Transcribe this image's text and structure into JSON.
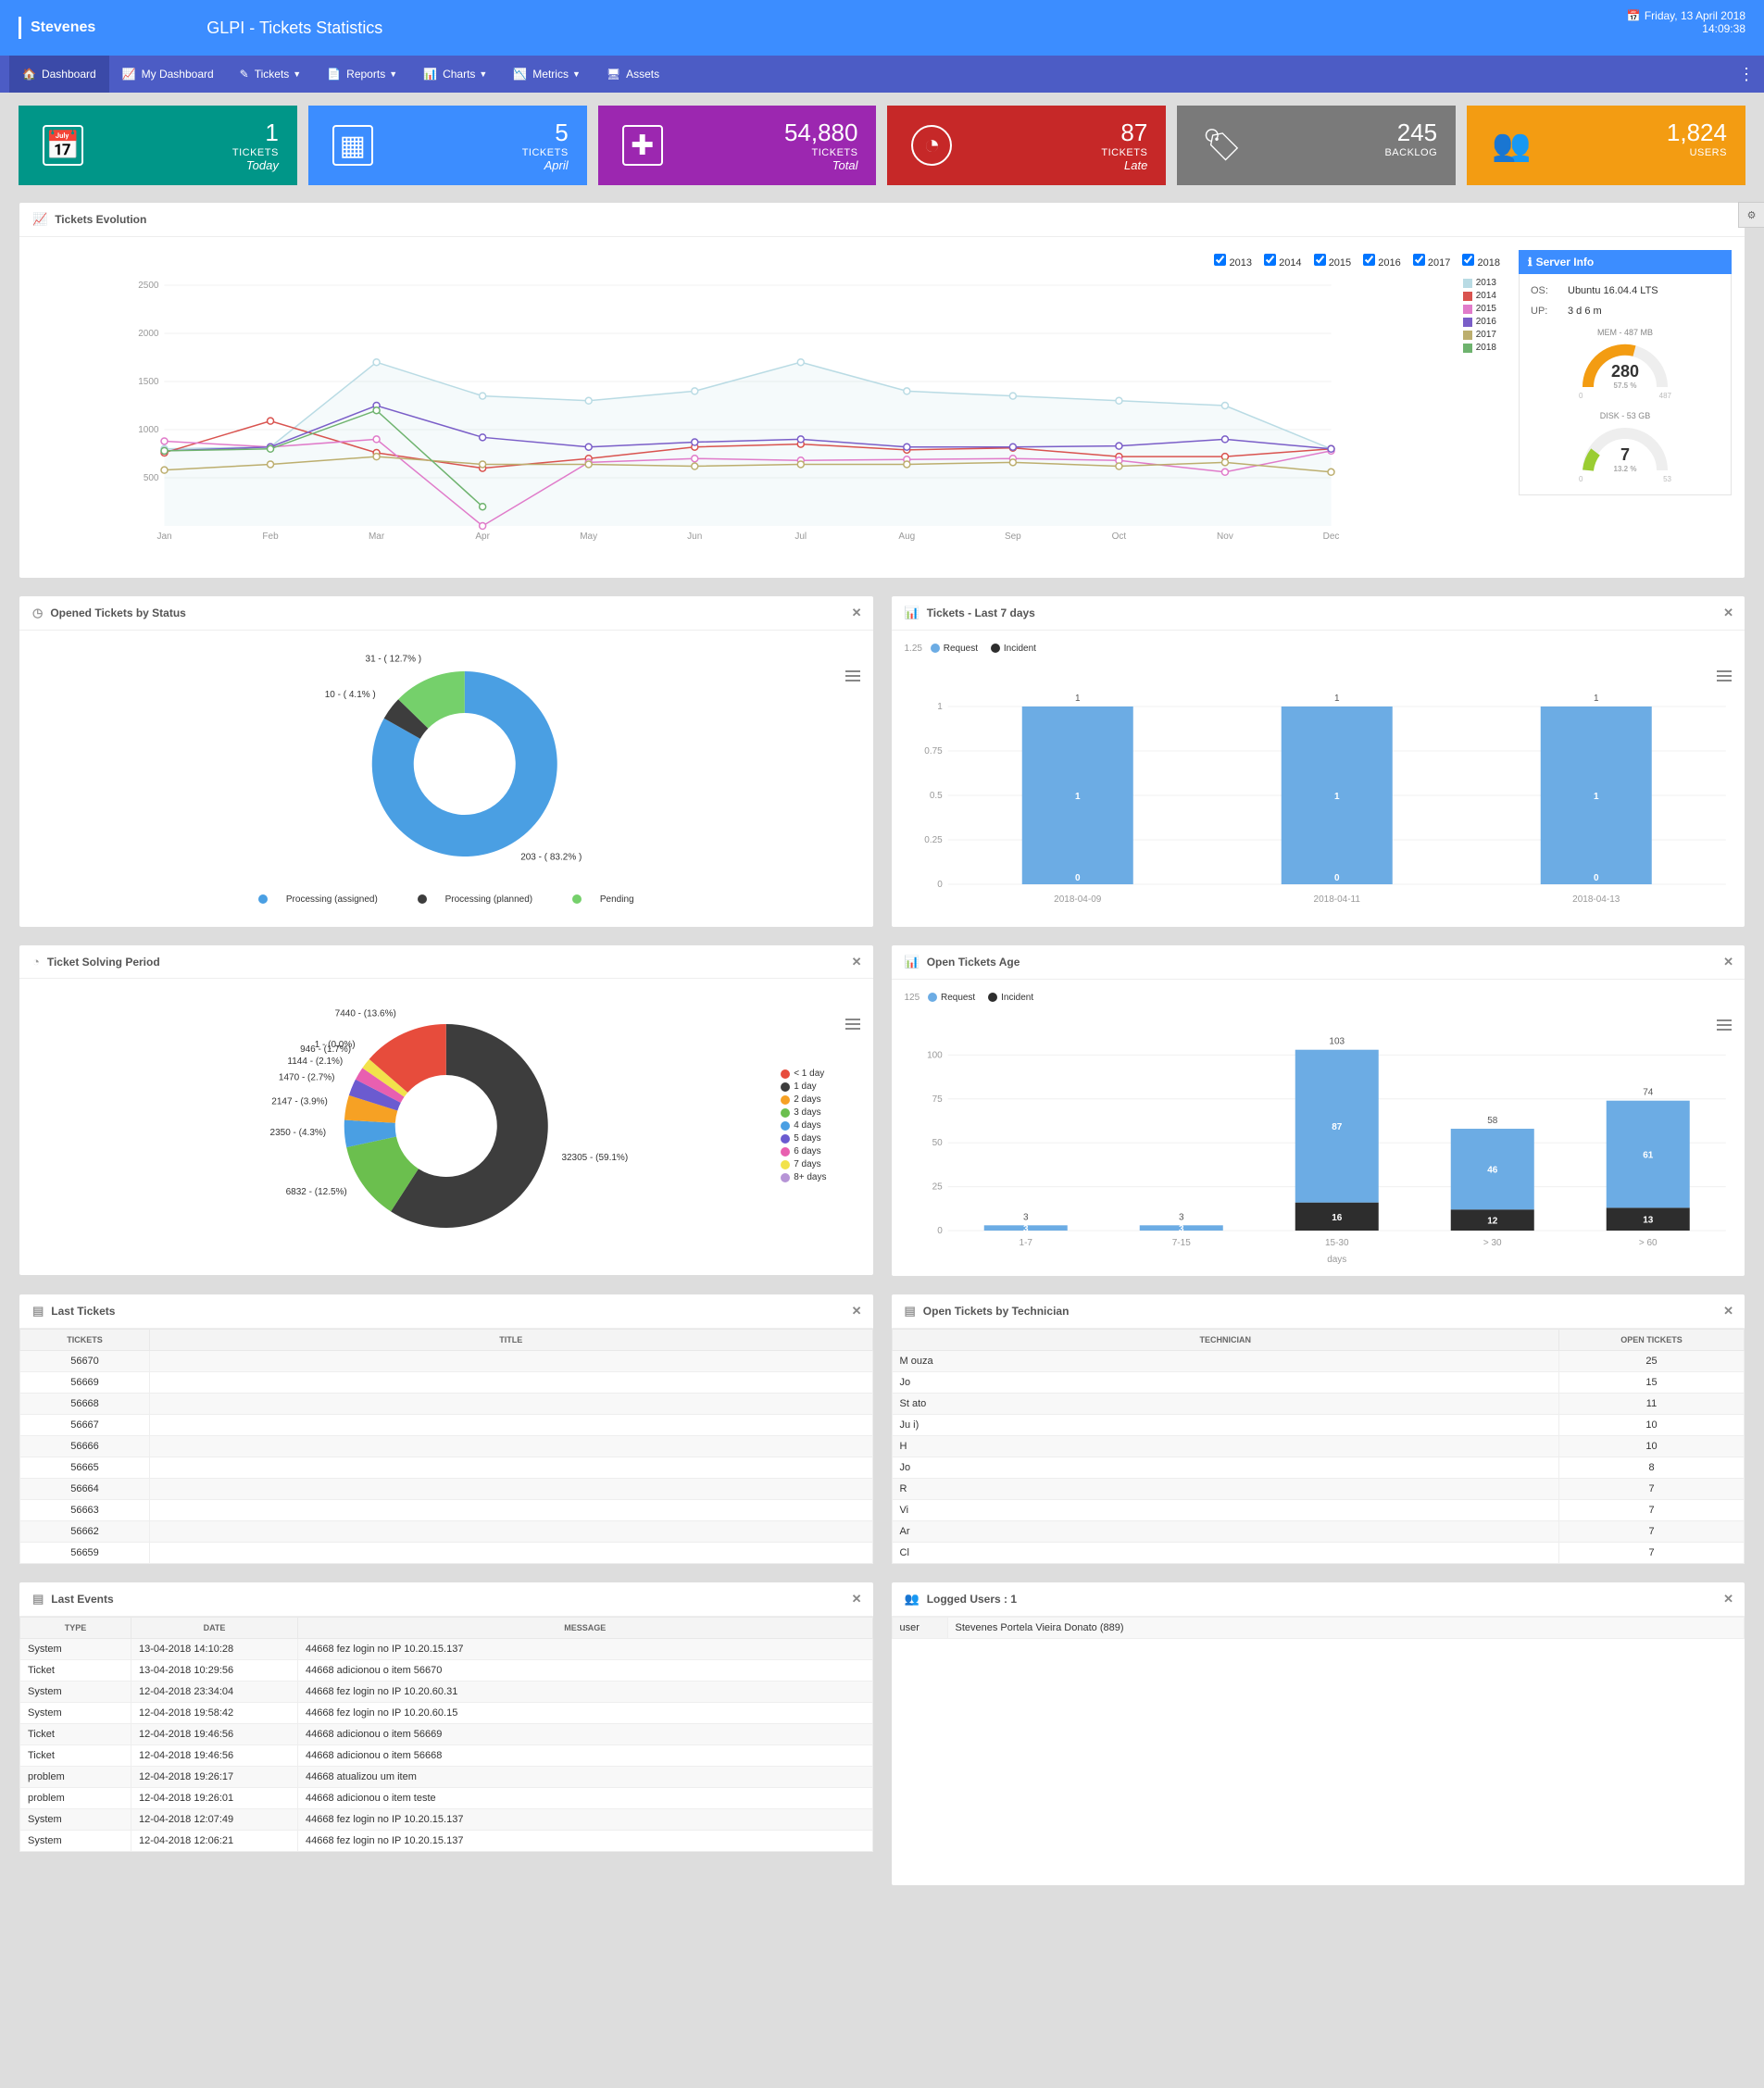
{
  "topbar": {
    "brand": "Stevenes",
    "title": "GLPI - Tickets Statistics",
    "date": "Friday, 13 April 2018",
    "time": "14:09:38"
  },
  "nav": {
    "dashboard": "Dashboard",
    "my_dashboard": "My Dashboard",
    "tickets": "Tickets",
    "reports": "Reports",
    "charts": "Charts",
    "metrics": "Metrics",
    "assets": "Assets"
  },
  "stats": {
    "today": {
      "number": "1",
      "label1": "TICKETS",
      "label2": "Today"
    },
    "april": {
      "number": "5",
      "label1": "TICKETS",
      "label2": "April"
    },
    "total": {
      "number": "54,880",
      "label1": "TICKETS",
      "label2": "Total"
    },
    "late": {
      "number": "87",
      "label1": "TICKETS",
      "label2": "Late"
    },
    "backlog": {
      "number": "245",
      "label1": "BACKLOG",
      "label2": ""
    },
    "users": {
      "number": "1,824",
      "label1": "USERS",
      "label2": ""
    }
  },
  "evolution": {
    "title": "Tickets Evolution",
    "years": [
      "2013",
      "2014",
      "2015",
      "2016",
      "2017",
      "2018"
    ],
    "server_info": {
      "title": "Server Info",
      "os_k": "OS:",
      "os_v": "Ubuntu 16.04.4 LTS",
      "up_k": "UP:",
      "up_v": "3 d 6 m",
      "mem_label": "MEM - 487 MB",
      "mem_val": "280",
      "mem_pct": "57.5 %",
      "mem_min": "0",
      "mem_max": "487",
      "disk_label": "DISK - 53 GB",
      "disk_val": "7",
      "disk_pct": "13.2 %",
      "disk_min": "0",
      "disk_max": "53"
    }
  },
  "status_pie": {
    "title": "Opened Tickets by Status",
    "l_proc_assigned": "Processing (assigned)",
    "l_proc_planned": "Processing (planned)",
    "l_pending": "Pending",
    "label_203": "203 - ( 83.2% )",
    "label_10": "10 - ( 4.1% )",
    "label_31": "31 - ( 12.7% )"
  },
  "last7": {
    "title": "Tickets - Last 7 days",
    "l_req": "Request",
    "l_inc": "Incident",
    "ytick_125": "1.25",
    "ytick_1": "1",
    "ytick_075": "0.75",
    "ytick_05": "0.5",
    "ytick_025": "0.25",
    "ytick_0": "0",
    "d1": "2018-04-09",
    "d2": "2018-04-11",
    "d3": "2018-04-13",
    "top1": "1",
    "top2": "1",
    "top3": "1",
    "mid1": "1",
    "mid2": "1",
    "mid3": "1",
    "bot1": "0",
    "bot2": "0",
    "bot3": "0"
  },
  "solving": {
    "title": "Ticket Solving Period",
    "leg": [
      "< 1 day",
      "1 day",
      "2 days",
      "3 days",
      "4 days",
      "5 days",
      "6 days",
      "7 days",
      "8+ days"
    ],
    "lbl_1": "1 - (0.0%)",
    "lbl_7440": "7440 - (13.6%)",
    "lbl_946": "946 - (1.7%)",
    "lbl_1144": "1144 - (2.1%)",
    "lbl_1470": "1470 - (2.7%)",
    "lbl_2147": "2147 - (3.9%)",
    "lbl_2350": "2350 - (4.3%)",
    "lbl_6832": "6832 - (12.5%)",
    "lbl_32305": "32305 - (59.1%)"
  },
  "age": {
    "title": "Open Tickets Age",
    "l_req": "Request",
    "l_inc": "Incident",
    "ymax": "125",
    "y100": "100",
    "y75": "75",
    "y50": "50",
    "y25": "25",
    "y0": "0",
    "xl": "days",
    "x1": "1-7",
    "x2": "7-15",
    "x3": "15-30",
    "x4": "> 30",
    "x5": "> 60",
    "top1": "3",
    "top2": "3",
    "top3": "103",
    "top4": "58",
    "top5": "74",
    "req1": "3",
    "req2": "3",
    "req3": "87",
    "req4": "46",
    "req5": "61",
    "inc1": "0",
    "inc2": "0",
    "inc3": "16",
    "inc4": "12",
    "inc5": "13"
  },
  "last_tickets": {
    "title": "Last Tickets",
    "col_tickets": "Tickets",
    "col_title": "Title",
    "rows": [
      {
        "id": "56670",
        "t": " "
      },
      {
        "id": "56669",
        "t": " "
      },
      {
        "id": "56668",
        "t": " "
      },
      {
        "id": "56667",
        "t": " "
      },
      {
        "id": "56666",
        "t": " "
      },
      {
        "id": "56665",
        "t": " "
      },
      {
        "id": "56664",
        "t": " "
      },
      {
        "id": "56663",
        "t": " "
      },
      {
        "id": "56662",
        "t": " "
      },
      {
        "id": "56659",
        "t": " "
      }
    ]
  },
  "by_tech": {
    "title": "Open Tickets by Technician",
    "col_tech": "Technician",
    "col_open": "Open Tickets",
    "rows": [
      {
        "n": "M                                                                                                                          ouza",
        "c": "25"
      },
      {
        "n": "Jo",
        "c": "15"
      },
      {
        "n": "St                                                                                                                             ato",
        "c": "11"
      },
      {
        "n": "Ju                                                                                                                             i)",
        "c": "10"
      },
      {
        "n": "H",
        "c": "10"
      },
      {
        "n": "Jo",
        "c": "8"
      },
      {
        "n": "R",
        "c": "7"
      },
      {
        "n": "Vi",
        "c": "7"
      },
      {
        "n": "Ar",
        "c": "7"
      },
      {
        "n": "Cl",
        "c": "7"
      }
    ]
  },
  "last_events": {
    "title": "Last Events",
    "col_type": "Type",
    "col_date": "Date",
    "col_msg": "Message",
    "rows": [
      {
        "t": "System",
        "d": "13-04-2018 14:10:28",
        "m": "44668 fez login no IP 10.20.15.137"
      },
      {
        "t": "Ticket",
        "d": "13-04-2018 10:29:56",
        "m": "44668 adicionou o item 56670"
      },
      {
        "t": "System",
        "d": "12-04-2018 23:34:04",
        "m": "44668 fez login no IP 10.20.60.31"
      },
      {
        "t": "System",
        "d": "12-04-2018 19:58:42",
        "m": "44668 fez login no IP 10.20.60.15"
      },
      {
        "t": "Ticket",
        "d": "12-04-2018 19:46:56",
        "m": "44668 adicionou o item 56669"
      },
      {
        "t": "Ticket",
        "d": "12-04-2018 19:46:56",
        "m": "44668 adicionou o item 56668"
      },
      {
        "t": "problem",
        "d": "12-04-2018 19:26:17",
        "m": "44668 atualizou um item"
      },
      {
        "t": "problem",
        "d": "12-04-2018 19:26:01",
        "m": "44668 adicionou o item teste"
      },
      {
        "t": "System",
        "d": "12-04-2018 12:07:49",
        "m": "44668 fez login no IP 10.20.15.137"
      },
      {
        "t": "System",
        "d": "12-04-2018 12:06:21",
        "m": "44668 fez login no IP 10.20.15.137"
      }
    ]
  },
  "logged": {
    "title": "Logged Users : 1",
    "col_user": "user",
    "user_name": "Stevenes Portela Vieira Donato (889)"
  },
  "chart_data": {
    "evolution": {
      "type": "line",
      "title": "Tickets Evolution",
      "categories": [
        "Jan",
        "Feb",
        "Mar",
        "Apr",
        "May",
        "Jun",
        "Jul",
        "Aug",
        "Sep",
        "Oct",
        "Nov",
        "Dec"
      ],
      "ylim": [
        0,
        2500
      ],
      "yticks": [
        500,
        1000,
        1500,
        2000,
        2500
      ],
      "series": [
        {
          "name": "2013",
          "color": "#b9dbe4",
          "values": [
            800,
            820,
            1700,
            1350,
            1300,
            1400,
            1700,
            1400,
            1350,
            1300,
            1250,
            800
          ]
        },
        {
          "name": "2014",
          "color": "#d9534f",
          "values": [
            760,
            1090,
            760,
            600,
            700,
            820,
            850,
            790,
            810,
            720,
            720,
            800
          ]
        },
        {
          "name": "2015",
          "color": "#e07bca",
          "values": [
            880,
            820,
            900,
            0,
            660,
            700,
            680,
            690,
            700,
            680,
            560,
            780
          ]
        },
        {
          "name": "2016",
          "color": "#7a5ec8",
          "values": [
            780,
            820,
            1250,
            920,
            820,
            870,
            900,
            820,
            820,
            830,
            900,
            800
          ]
        },
        {
          "name": "2017",
          "color": "#bcae6e",
          "values": [
            580,
            640,
            720,
            640,
            640,
            620,
            640,
            640,
            660,
            620,
            660,
            560
          ]
        },
        {
          "name": "2018",
          "color": "#6eb36e",
          "values": [
            780,
            800,
            1200,
            200,
            null,
            null,
            null,
            null,
            null,
            null,
            null,
            null
          ]
        }
      ]
    },
    "status_donut": {
      "type": "pie",
      "series": [
        {
          "name": "Processing (assigned)",
          "value": 203,
          "pct": 83.2,
          "color": "#4a9fe3"
        },
        {
          "name": "Processing (planned)",
          "value": 10,
          "pct": 4.1,
          "color": "#3d3d3d"
        },
        {
          "name": "Pending",
          "value": 31,
          "pct": 12.7,
          "color": "#75d06b"
        }
      ]
    },
    "last7_bar": {
      "type": "bar",
      "categories": [
        "2018-04-09",
        "2018-04-11",
        "2018-04-13"
      ],
      "ylim": [
        0,
        1.25
      ],
      "series": [
        {
          "name": "Request",
          "color": "#6cace4",
          "values": [
            1,
            1,
            1
          ]
        },
        {
          "name": "Incident",
          "color": "#2d2d2d",
          "values": [
            0,
            0,
            0
          ]
        }
      ]
    },
    "solving_donut": {
      "type": "pie",
      "series": [
        {
          "name": "< 1 day",
          "value": 32305,
          "pct": 59.1,
          "color": "#3d3d3d"
        },
        {
          "name": "1 day",
          "value": 6832,
          "pct": 12.5,
          "color": "#6bbf4e"
        },
        {
          "name": "2 days",
          "value": 2350,
          "pct": 4.3,
          "color": "#4a9fe3"
        },
        {
          "name": "3 days",
          "value": 2147,
          "pct": 3.9,
          "color": "#f6a124"
        },
        {
          "name": "4 days",
          "value": 1470,
          "pct": 2.7,
          "color": "#6b5bd0"
        },
        {
          "name": "5 days",
          "value": 1144,
          "pct": 2.1,
          "color": "#e85fb0"
        },
        {
          "name": "6 days",
          "value": 946,
          "pct": 1.7,
          "color": "#f2e24b"
        },
        {
          "name": "7 days",
          "value": 1,
          "pct": 0.0,
          "color": "#b694d6"
        },
        {
          "name": "8+ days",
          "value": 7440,
          "pct": 13.6,
          "color": "#e74c3c"
        }
      ]
    },
    "age_stacked": {
      "type": "bar",
      "categories": [
        "1-7",
        "7-15",
        "15-30",
        "> 30",
        "> 60"
      ],
      "ylim": [
        0,
        125
      ],
      "xlabel": "days",
      "series": [
        {
          "name": "Request",
          "color": "#6cace4",
          "values": [
            3,
            3,
            87,
            46,
            61
          ]
        },
        {
          "name": "Incident",
          "color": "#2d2d2d",
          "values": [
            0,
            0,
            16,
            12,
            13
          ]
        }
      ],
      "totals": [
        3,
        3,
        103,
        58,
        74
      ]
    }
  }
}
